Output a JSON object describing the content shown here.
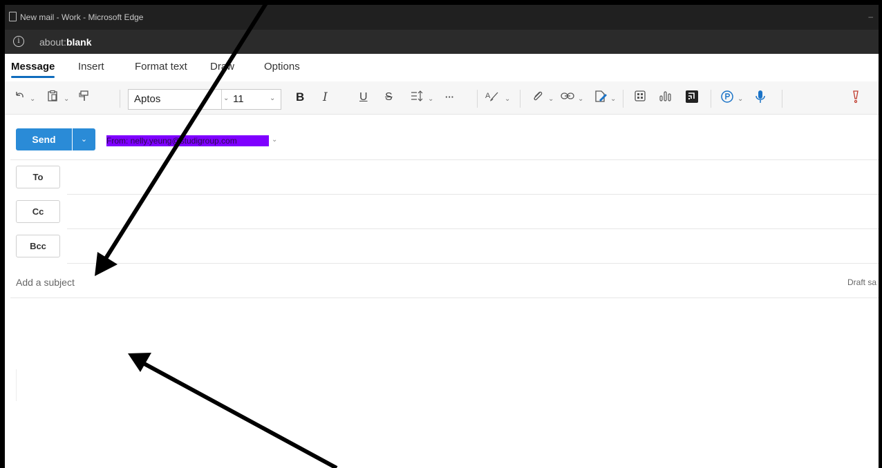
{
  "window": {
    "title": "New mail - Work - Microsoft Edge",
    "minimize": "–"
  },
  "address_bar": {
    "info_icon": "i",
    "url_prefix": "about:",
    "url_host": "blank"
  },
  "ribbon": {
    "tabs": [
      "Message",
      "Insert",
      "Format text",
      "Draw",
      "Options"
    ],
    "active_tab": "Message"
  },
  "toolbar": {
    "font_name": "Aptos",
    "font_size": "11",
    "bold": "B",
    "italic": "I",
    "underline": "U",
    "strikethrough": "S",
    "more": "···"
  },
  "compose": {
    "send_label": "Send",
    "from_label": "From: nelly.yeung@studigroup.com",
    "to_label": "To",
    "cc_label": "Cc",
    "bcc_label": "Bcc",
    "subject_placeholder": "Add a subject",
    "draft_status": "Draft sa"
  },
  "colors": {
    "accent": "#2a8bd7",
    "from_highlight": "#7f00ff",
    "titlebar": "#202020",
    "addressbar": "#2b2b2b",
    "arrow": "#000000"
  },
  "icons": [
    "undo-icon",
    "paste-icon",
    "format-painter-icon",
    "line-spacing-icon",
    "styles-icon",
    "attach-icon",
    "link-icon",
    "signature-icon",
    "apps-icon",
    "poll-icon",
    "viva-icon",
    "copilot-icon",
    "dictate-icon",
    "importance-icon",
    "info-icon"
  ]
}
